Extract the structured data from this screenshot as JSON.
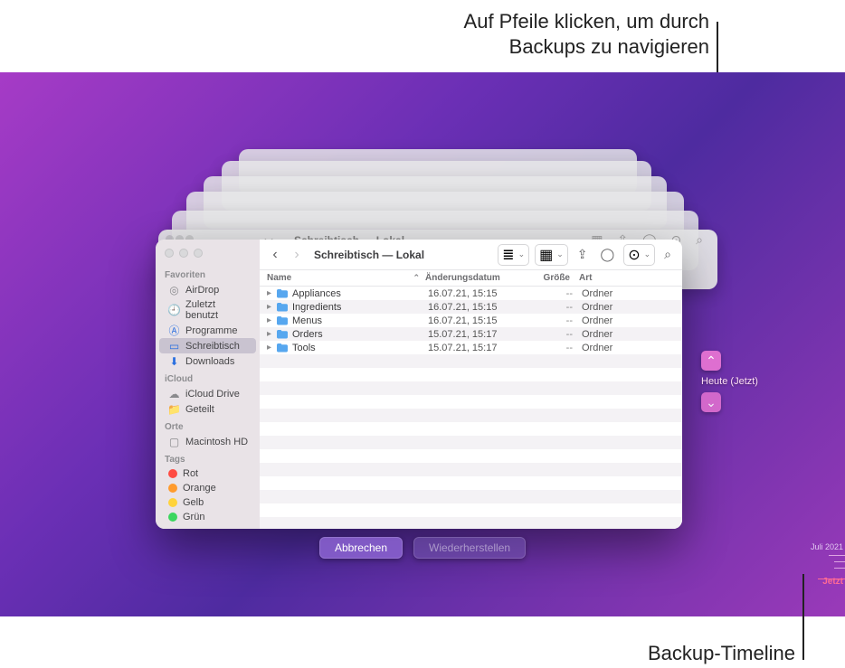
{
  "callouts": {
    "top_line1": "Auf Pfeile klicken, um durch",
    "top_line2": "Backups zu navigieren",
    "bottom": "Backup-Timeline"
  },
  "ghost_title": "Schreibtisch — Lokal",
  "window": {
    "title": "Schreibtisch — Lokal"
  },
  "sidebar": {
    "headings": {
      "fav": "Favoriten",
      "icloud": "iCloud",
      "orte": "Orte",
      "tags": "Tags"
    },
    "fav": [
      {
        "label": "AirDrop",
        "icon": "airdrop"
      },
      {
        "label": "Zuletzt benutzt",
        "icon": "recent"
      },
      {
        "label": "Programme",
        "icon": "apps"
      },
      {
        "label": "Schreibtisch",
        "icon": "desktop"
      },
      {
        "label": "Downloads",
        "icon": "downloads"
      }
    ],
    "icloud": [
      {
        "label": "iCloud Drive",
        "icon": "cloud"
      },
      {
        "label": "Geteilt",
        "icon": "shared"
      }
    ],
    "orte": [
      {
        "label": "Macintosh HD",
        "icon": "disk"
      }
    ],
    "tags": [
      {
        "label": "Rot",
        "color": "#ff4b42"
      },
      {
        "label": "Orange",
        "color": "#ff9b2d"
      },
      {
        "label": "Gelb",
        "color": "#ffd33b"
      },
      {
        "label": "Grün",
        "color": "#3bd65e"
      }
    ]
  },
  "columns": {
    "name": "Name",
    "date": "Änderungsdatum",
    "size": "Größe",
    "kind": "Art"
  },
  "rows": [
    {
      "name": "Appliances",
      "date": "16.07.21, 15:15",
      "size": "--",
      "kind": "Ordner"
    },
    {
      "name": "Ingredients",
      "date": "16.07.21, 15:15",
      "size": "--",
      "kind": "Ordner"
    },
    {
      "name": "Menus",
      "date": "16.07.21, 15:15",
      "size": "--",
      "kind": "Ordner"
    },
    {
      "name": "Orders",
      "date": "15.07.21, 15:17",
      "size": "--",
      "kind": "Ordner"
    },
    {
      "name": "Tools",
      "date": "15.07.21, 15:17",
      "size": "--",
      "kind": "Ordner"
    }
  ],
  "tm_nav": {
    "current": "Heute (Jetzt)"
  },
  "buttons": {
    "cancel": "Abbrechen",
    "restore": "Wiederherstellen"
  },
  "timeline": {
    "month": "Juli 2021",
    "now": "Jetzt"
  }
}
